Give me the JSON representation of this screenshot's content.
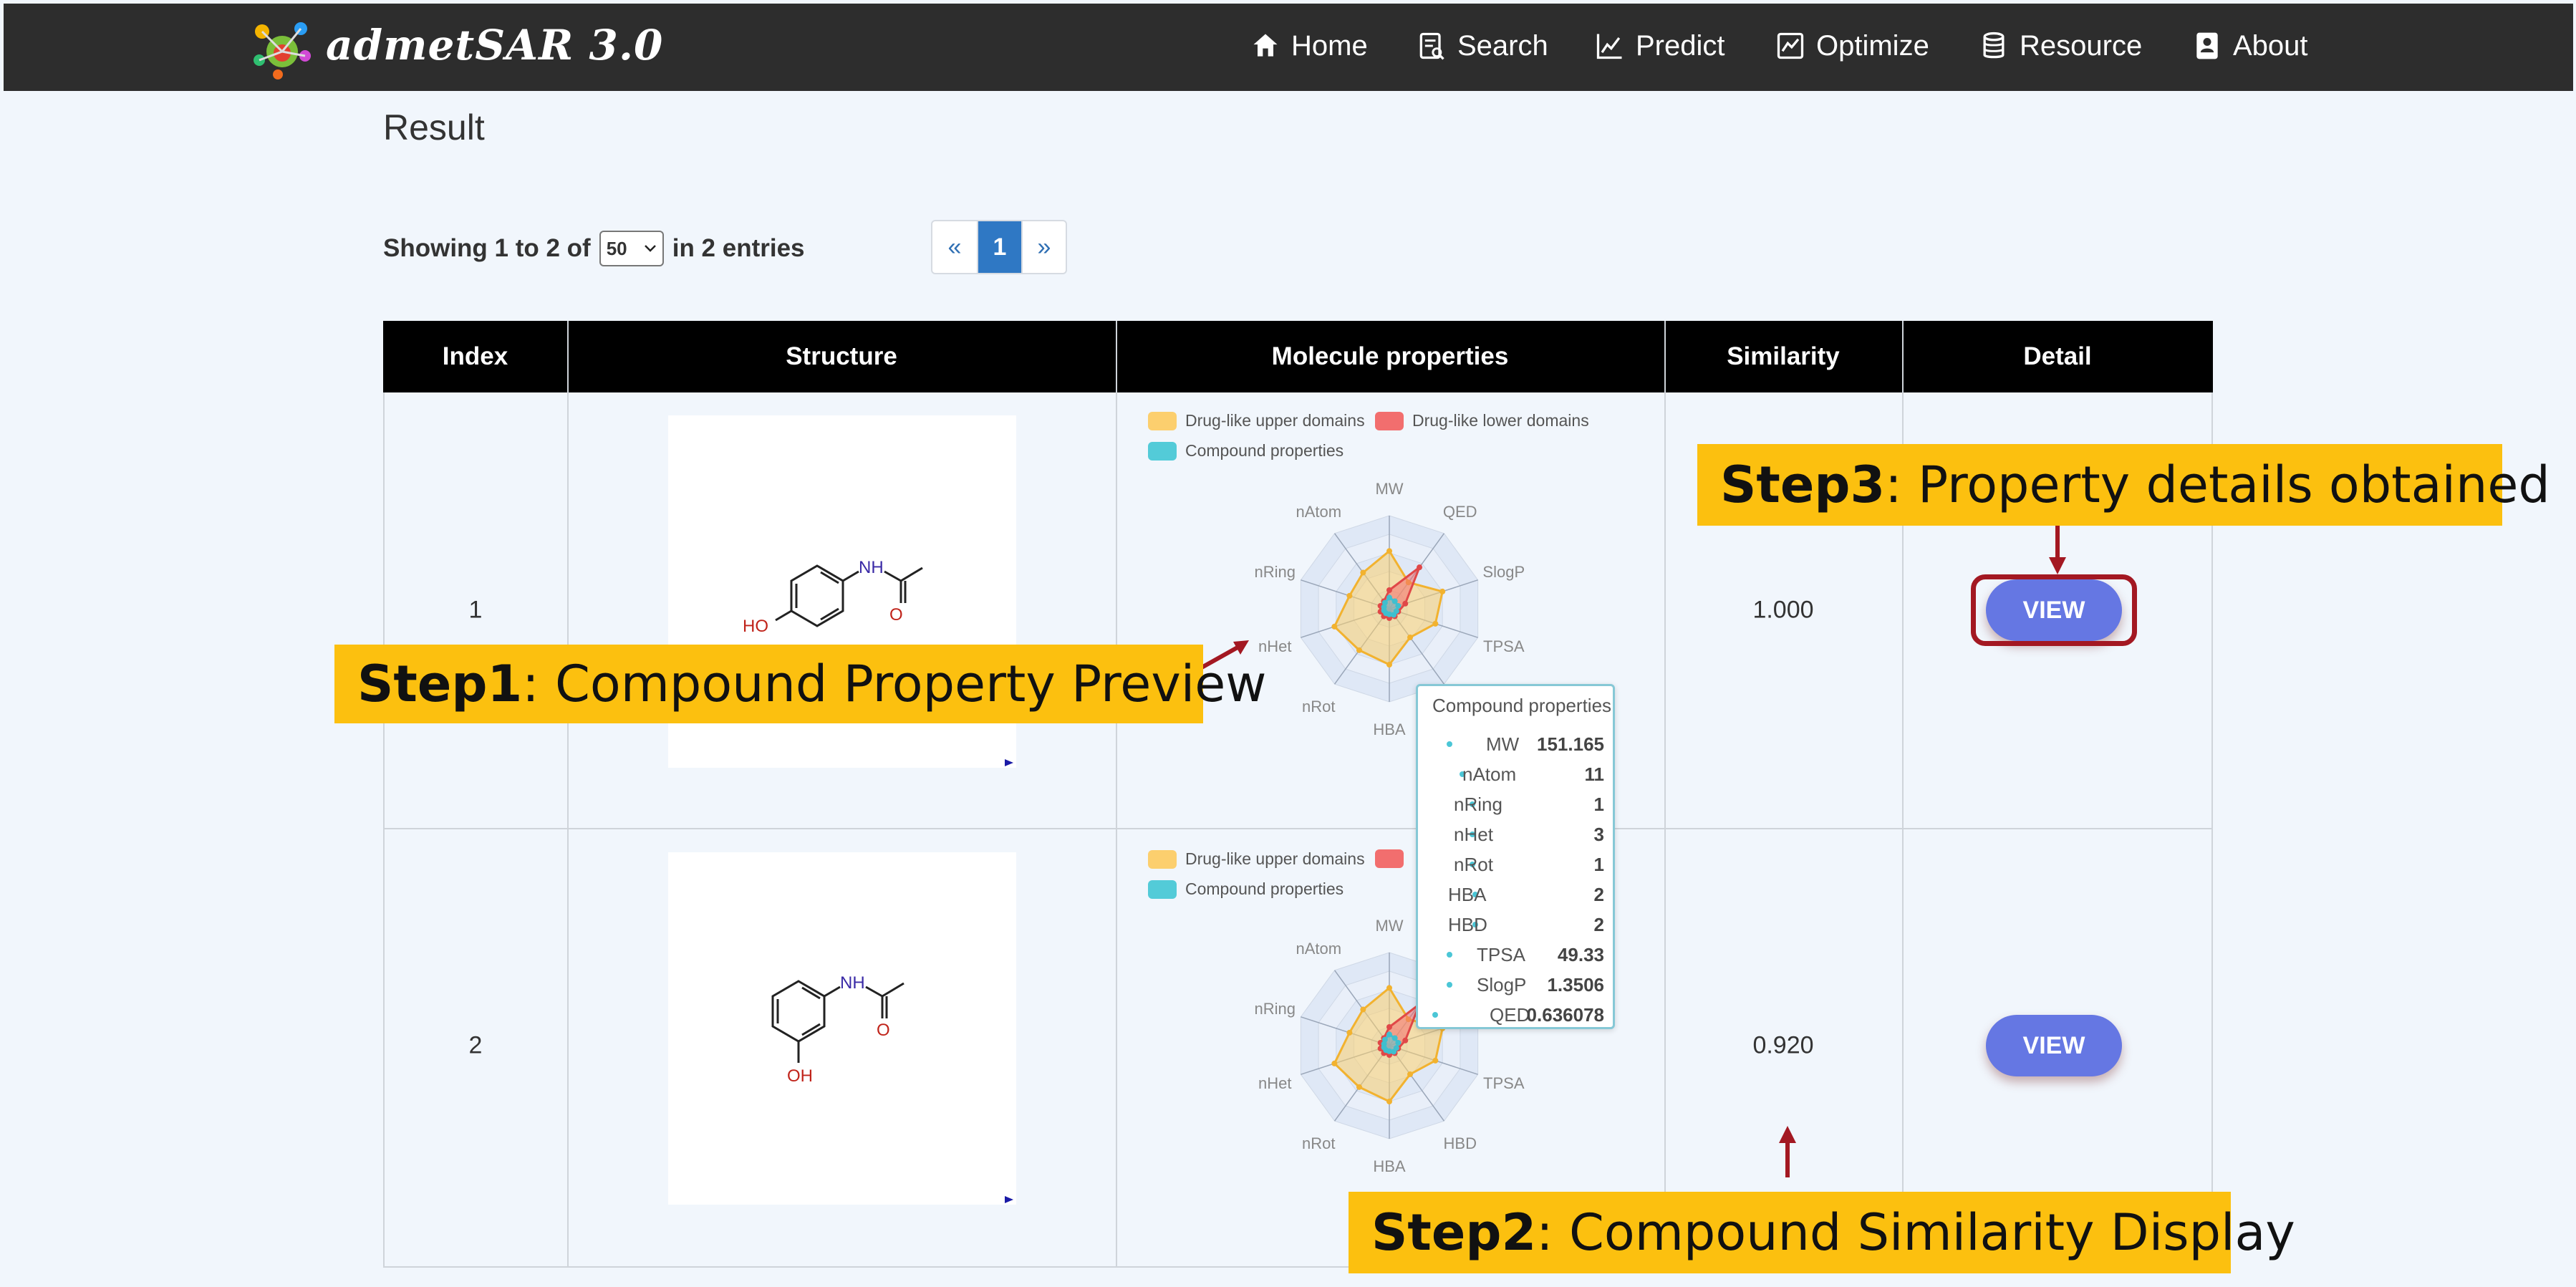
{
  "navbar": {
    "brand": "admetSAR 3.0",
    "items": [
      {
        "label": "Home",
        "icon": "home-icon"
      },
      {
        "label": "Search",
        "icon": "search-document-icon"
      },
      {
        "label": "Predict",
        "icon": "chart-line-icon"
      },
      {
        "label": "Optimize",
        "icon": "chart-box-icon"
      },
      {
        "label": "Resource",
        "icon": "database-icon"
      },
      {
        "label": "About",
        "icon": "contact-card-icon"
      }
    ]
  },
  "result": {
    "title": "Result",
    "showing_prefix": "Showing 1 to 2 of",
    "page_size": "50",
    "showing_suffix": "in 2 entries",
    "pager": {
      "prev": "«",
      "current": "1",
      "next": "»"
    }
  },
  "table": {
    "headers": [
      "Index",
      "Structure",
      "Molecule properties",
      "Similarity",
      "Detail"
    ],
    "rows": [
      {
        "index": "1",
        "similarity": "1.000",
        "detail_label": "VIEW",
        "atoms": {
          "nh": "NH",
          "o": "O",
          "ho": "HO"
        }
      },
      {
        "index": "2",
        "similarity": "0.920",
        "detail_label": "VIEW",
        "atoms": {
          "nh": "NH",
          "o": "O",
          "oh": "OH"
        }
      }
    ]
  },
  "radar": {
    "legend": {
      "upper": "Drug-like upper domains",
      "lower": "Drug-like lower domains",
      "compound": "Compound properties"
    },
    "axes": [
      "MW",
      "QED",
      "SlogP",
      "TPSA",
      "HBD",
      "HBA",
      "nRot",
      "nHet",
      "nRing",
      "nAtom"
    ],
    "colors": {
      "upper": "#fccf6e",
      "lower": "#f26e6e",
      "compound": "#53cbd8"
    }
  },
  "tooltip": {
    "title": "Compound properties",
    "rows": [
      {
        "label": "MW",
        "value": "151.165"
      },
      {
        "label": "nAtom",
        "value": "11"
      },
      {
        "label": "nRing",
        "value": "1"
      },
      {
        "label": "nHet",
        "value": "3"
      },
      {
        "label": "nRot",
        "value": "1"
      },
      {
        "label": "HBA",
        "value": "2"
      },
      {
        "label": "HBD",
        "value": "2"
      },
      {
        "label": "TPSA",
        "value": "49.33"
      },
      {
        "label": "SlogP",
        "value": "1.3506"
      },
      {
        "label": "QED",
        "value": "0.636078"
      }
    ]
  },
  "callouts": {
    "step1": {
      "bold": "Step1",
      "text": ": Compound Property Preview"
    },
    "step2": {
      "bold": "Step2",
      "text": ": Compound Similarity Display"
    },
    "step3": {
      "bold": "Step3",
      "text": ": Property details obtained"
    }
  }
}
